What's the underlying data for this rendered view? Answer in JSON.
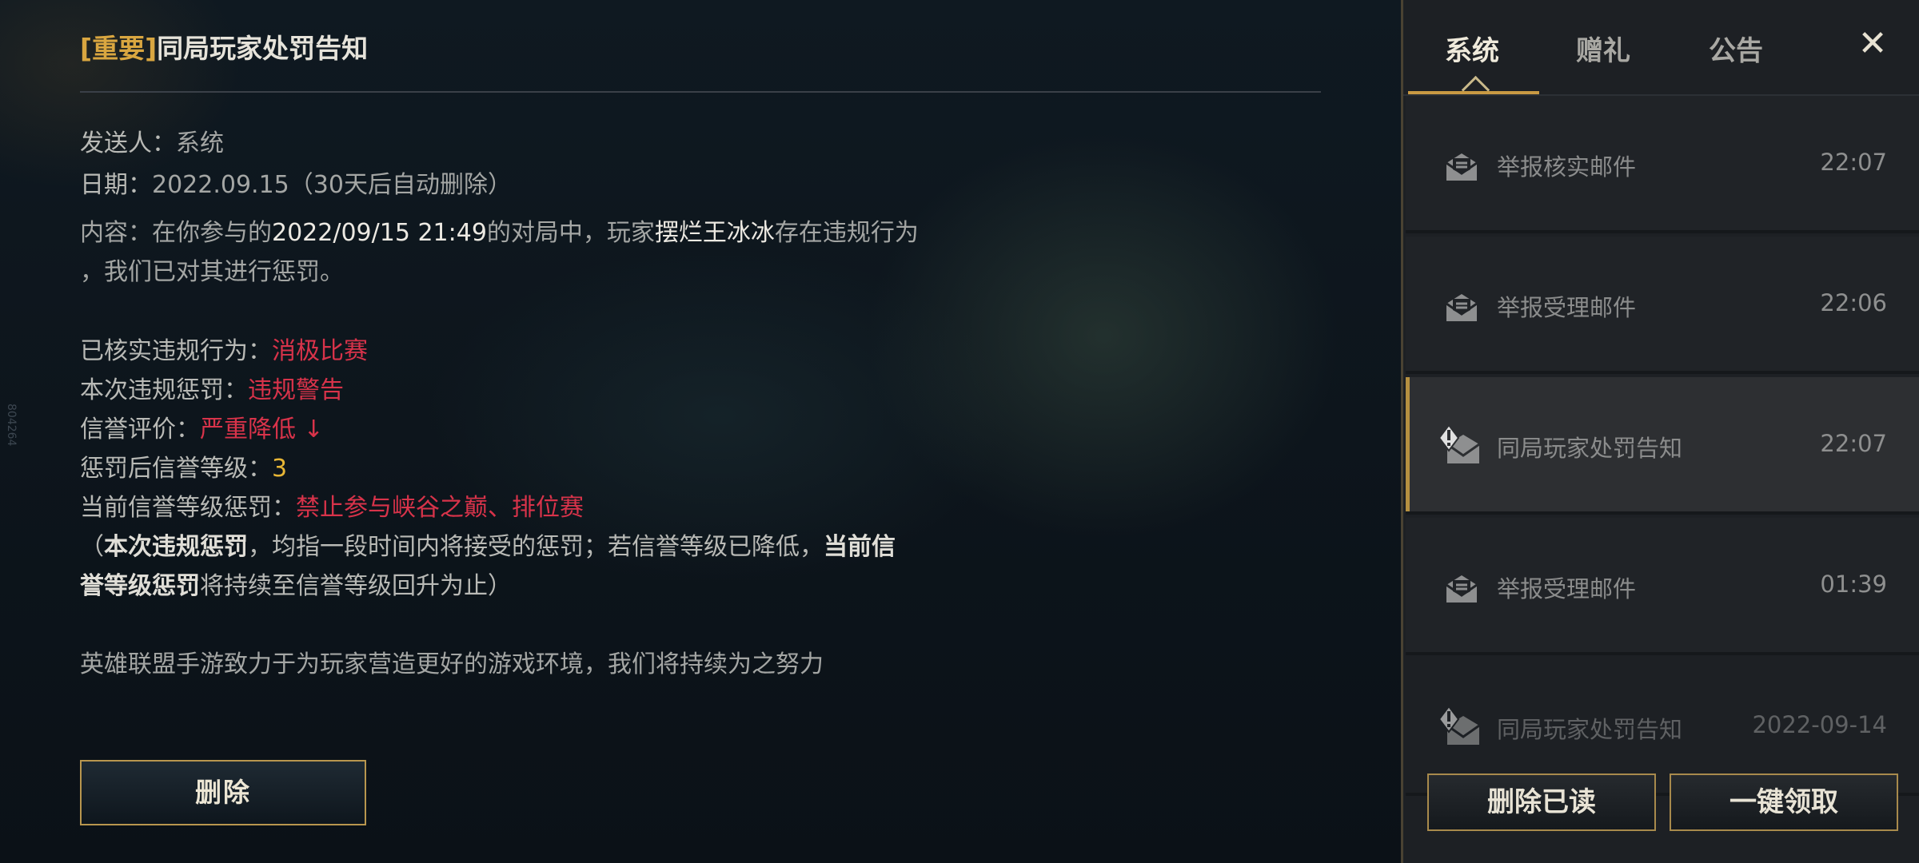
{
  "mail_detail": {
    "title_tag": "[重要]",
    "title": "同局玩家处罚告知",
    "sender_label": "发送人：",
    "sender_value": "系统",
    "date_label": "日期：",
    "date_value": "2022.09.15（30天后自动删除）",
    "content_p1": "内容：在你参与的",
    "content_time": "2022/09/15 21:49",
    "content_p2": "的对局中，玩家",
    "content_player": "摆烂王冰冰",
    "content_p3": "存在违规行为",
    "content_line2": "，我们已对其进行惩罚。",
    "verified_label": "已核实违规行为：",
    "verified_value": "消极比赛",
    "penalty_label": "本次违规惩罚：",
    "penalty_value": "违规警告",
    "credit_label": "信誉评价：",
    "credit_value": "严重降低 ↓",
    "level_label": "惩罚后信誉等级：",
    "level_value": "3",
    "current_label": "当前信誉等级惩罚：",
    "current_value": "禁止参与峡谷之巅、排位赛",
    "note_open": "（",
    "note_b1": "本次违规惩罚",
    "note_mid": "，均指一段时间内将接受的惩罚；若信誉等级已降低，",
    "note_b2a": "当前信",
    "note_b2b": "誉等级惩罚",
    "note_end": "将持续至信誉等级回升为止）",
    "closing": "英雄联盟手游致力于为玩家营造更好的游戏环境，我们将持续为之努力",
    "delete_button": "删除",
    "side_id": "804264"
  },
  "tabs": [
    {
      "label": "系统",
      "active": true
    },
    {
      "label": "赠礼",
      "active": false
    },
    {
      "label": "公告",
      "active": false
    }
  ],
  "close_label": "✕",
  "mail_list": [
    {
      "icon": "envelope-read-icon",
      "name": "举报核实邮件",
      "time": "22:07"
    },
    {
      "icon": "envelope-read-icon",
      "name": "举报受理邮件",
      "time": "22:06"
    },
    {
      "icon": "envelope-alert-icon",
      "name": "同局玩家处罚告知",
      "time": "22:07",
      "selected": true
    },
    {
      "icon": "envelope-read-icon",
      "name": "举报受理邮件",
      "time": "01:39"
    },
    {
      "icon": "envelope-alert-icon",
      "name": "同局玩家处罚告知",
      "time": "2022-09-14"
    }
  ],
  "footer": {
    "delete_read": "删除已读",
    "claim_all": "一键领取"
  },
  "colors": {
    "accent_gold": "#d9a640",
    "warning_red": "#d8334a",
    "level_yellow": "#e8b635"
  }
}
